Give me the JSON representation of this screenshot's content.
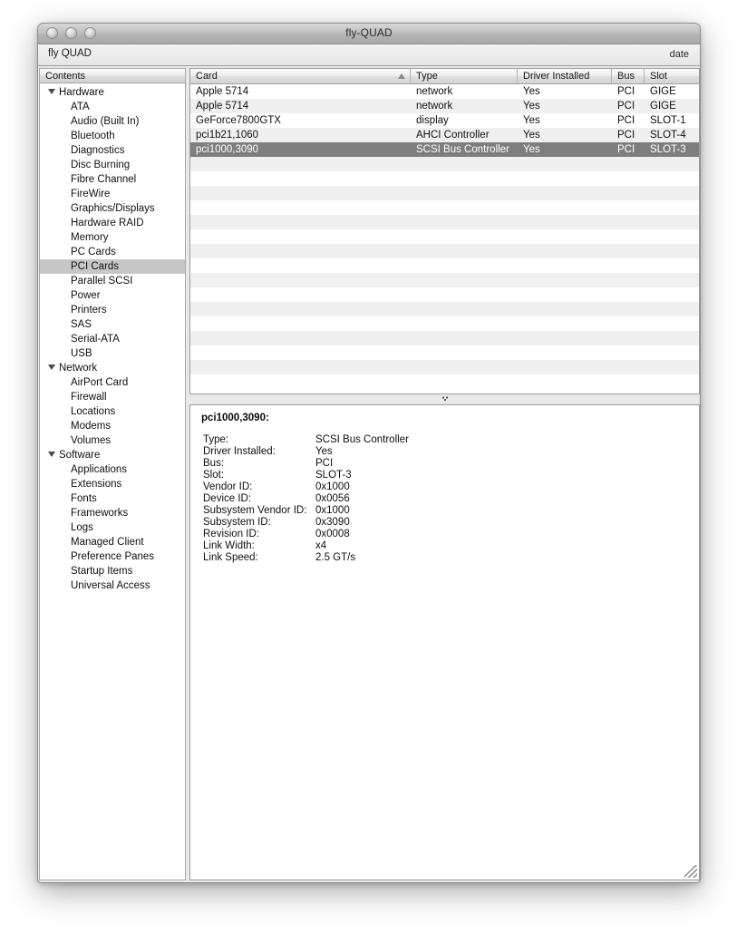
{
  "window": {
    "title": "fly-QUAD",
    "traffic_lights": [
      "close-button",
      "minimize-button",
      "zoom-button"
    ]
  },
  "toolbar": {
    "path_label": "fly QUAD",
    "right_label": "date"
  },
  "sidebar": {
    "header": "Contents",
    "items": [
      {
        "label": "Hardware",
        "type": "group",
        "expanded": true
      },
      {
        "label": "ATA",
        "type": "child"
      },
      {
        "label": "Audio (Built In)",
        "type": "child"
      },
      {
        "label": "Bluetooth",
        "type": "child"
      },
      {
        "label": "Diagnostics",
        "type": "child"
      },
      {
        "label": "Disc Burning",
        "type": "child"
      },
      {
        "label": "Fibre Channel",
        "type": "child"
      },
      {
        "label": "FireWire",
        "type": "child"
      },
      {
        "label": "Graphics/Displays",
        "type": "child"
      },
      {
        "label": "Hardware RAID",
        "type": "child"
      },
      {
        "label": "Memory",
        "type": "child"
      },
      {
        "label": "PC Cards",
        "type": "child"
      },
      {
        "label": "PCI Cards",
        "type": "child",
        "selected": true
      },
      {
        "label": "Parallel SCSI",
        "type": "child"
      },
      {
        "label": "Power",
        "type": "child"
      },
      {
        "label": "Printers",
        "type": "child"
      },
      {
        "label": "SAS",
        "type": "child"
      },
      {
        "label": "Serial-ATA",
        "type": "child"
      },
      {
        "label": "USB",
        "type": "child"
      },
      {
        "label": "Network",
        "type": "group",
        "expanded": true
      },
      {
        "label": "AirPort Card",
        "type": "child"
      },
      {
        "label": "Firewall",
        "type": "child"
      },
      {
        "label": "Locations",
        "type": "child"
      },
      {
        "label": "Modems",
        "type": "child"
      },
      {
        "label": "Volumes",
        "type": "child"
      },
      {
        "label": "Software",
        "type": "group",
        "expanded": true
      },
      {
        "label": "Applications",
        "type": "child"
      },
      {
        "label": "Extensions",
        "type": "child"
      },
      {
        "label": "Fonts",
        "type": "child"
      },
      {
        "label": "Frameworks",
        "type": "child"
      },
      {
        "label": "Logs",
        "type": "child"
      },
      {
        "label": "Managed Client",
        "type": "child"
      },
      {
        "label": "Preference Panes",
        "type": "child"
      },
      {
        "label": "Startup Items",
        "type": "child"
      },
      {
        "label": "Universal Access",
        "type": "child"
      }
    ]
  },
  "table": {
    "columns": [
      {
        "label": "Card",
        "key": "card",
        "sorted": true,
        "sort_direction": "ascending"
      },
      {
        "label": "Type",
        "key": "type"
      },
      {
        "label": "Driver Installed",
        "key": "driver"
      },
      {
        "label": "Bus",
        "key": "bus"
      },
      {
        "label": "Slot",
        "key": "slot"
      }
    ],
    "rows": [
      {
        "card": "Apple 5714",
        "type": "network",
        "driver": "Yes",
        "bus": "PCI",
        "slot": "GIGE"
      },
      {
        "card": "Apple 5714",
        "type": "network",
        "driver": "Yes",
        "bus": "PCI",
        "slot": "GIGE"
      },
      {
        "card": "GeForce7800GTX",
        "type": "display",
        "driver": "Yes",
        "bus": "PCI",
        "slot": "SLOT-1"
      },
      {
        "card": "pci1b21,1060",
        "type": "AHCI Controller",
        "driver": "Yes",
        "bus": "PCI",
        "slot": "SLOT-4"
      },
      {
        "card": "pci1000,3090",
        "type": "SCSI Bus Controller",
        "driver": "Yes",
        "bus": "PCI",
        "slot": "SLOT-3",
        "selected": true
      }
    ],
    "empty_row_count": 16
  },
  "detail": {
    "title": "pci1000,3090:",
    "fields": [
      {
        "label": "Type:",
        "value": "SCSI Bus Controller"
      },
      {
        "label": "Driver Installed:",
        "value": "Yes"
      },
      {
        "label": "Bus:",
        "value": "PCI"
      },
      {
        "label": "Slot:",
        "value": "SLOT-3"
      },
      {
        "label": "Vendor ID:",
        "value": "0x1000"
      },
      {
        "label": "Device ID:",
        "value": "0x0056"
      },
      {
        "label": "Subsystem Vendor ID:",
        "value": "0x1000"
      },
      {
        "label": "Subsystem ID:",
        "value": "0x3090"
      },
      {
        "label": "Revision ID:",
        "value": "0x0008"
      },
      {
        "label": "Link Width:",
        "value": "x4"
      },
      {
        "label": "Link Speed:",
        "value": "2.5 GT/s"
      }
    ]
  },
  "colors": {
    "selection": "#7e7e7e",
    "sidebar_selection": "#c6c6c6",
    "alt_row": "#f0f0f0",
    "window_chrome": "#ededed"
  }
}
